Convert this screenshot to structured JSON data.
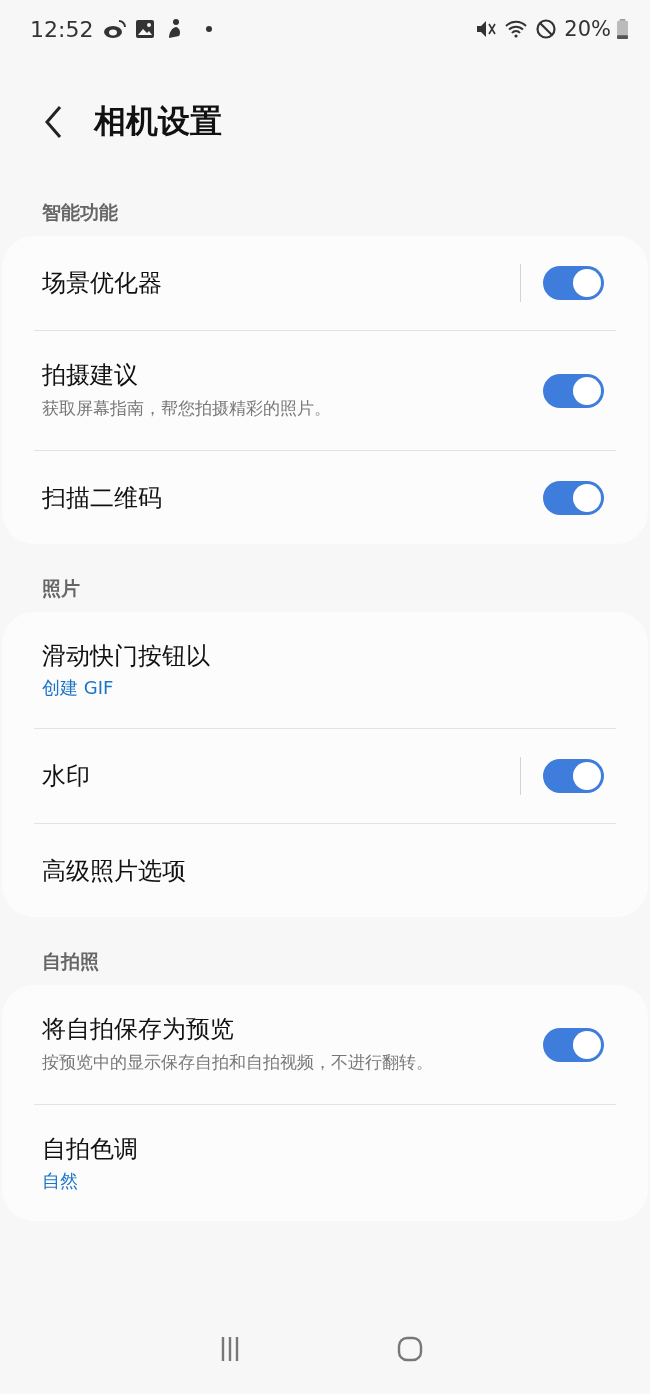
{
  "status_bar": {
    "time": "12:52",
    "battery": "20%"
  },
  "header": {
    "title": "相机设置"
  },
  "sections": [
    {
      "title": "智能功能",
      "items": [
        {
          "title": "场景优化器",
          "split": true,
          "toggle": {
            "on": true
          }
        },
        {
          "title": "拍摄建议",
          "summary": "获取屏幕指南，帮您拍摄精彩的照片。",
          "split": false,
          "toggle": {
            "on": true
          }
        },
        {
          "title": "扫描二维码",
          "split": false,
          "toggle": {
            "on": true
          }
        }
      ]
    },
    {
      "title": "照片",
      "items": [
        {
          "title": "滑动快门按钮以",
          "value": "创建 GIF"
        },
        {
          "title": "水印",
          "split": true,
          "toggle": {
            "on": true
          }
        },
        {
          "title": "高级照片选项"
        }
      ]
    },
    {
      "title": "自拍照",
      "items": [
        {
          "title": "将自拍保存为预览",
          "summary": "按预览中的显示保存自拍和自拍视频，不进行翻转。",
          "split": false,
          "toggle": {
            "on": true
          }
        },
        {
          "title": "自拍色调",
          "value": "自然"
        }
      ]
    }
  ]
}
